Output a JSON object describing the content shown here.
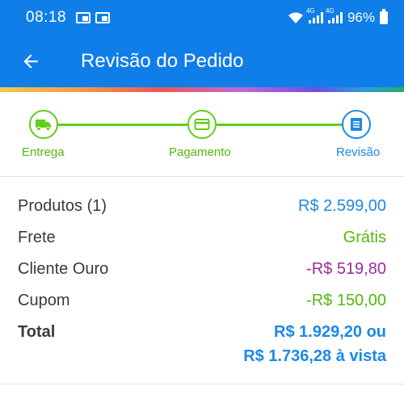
{
  "status_bar": {
    "time": "08:18",
    "network_tag_1": "4G",
    "network_tag_2": "4G",
    "battery": "96%",
    "icons": [
      "notification-icon",
      "notification-icon",
      "wifi-icon",
      "signal-icon",
      "signal-icon",
      "battery-icon"
    ]
  },
  "app_bar": {
    "title": "Revisão do Pedido",
    "back_icon": "arrow-left-icon"
  },
  "stepper": {
    "steps": [
      {
        "label": "Entrega",
        "icon": "truck-icon",
        "state": "completed"
      },
      {
        "label": "Pagamento",
        "icon": "credit-card-icon",
        "state": "completed"
      },
      {
        "label": "Revisão",
        "icon": "list-icon",
        "state": "current"
      }
    ],
    "colors": {
      "completed": "#5fcf1a",
      "current": "#1e88e5"
    }
  },
  "summary": {
    "rows": [
      {
        "label": "Produtos (1)",
        "value": "R$ 2.599,00"
      },
      {
        "label": "Frete",
        "value": "Grátis"
      },
      {
        "label": "Cliente Ouro",
        "value": "-R$ 519,80"
      },
      {
        "label": "Cupom",
        "value": "-R$ 150,00"
      }
    ],
    "total": {
      "label": "Total",
      "value_line1": "R$ 1.929,20 ou",
      "value_line2": "R$ 1.736,28 à vista"
    }
  },
  "colors": {
    "primary": "#0f7ee8",
    "accent_blue": "#1e88e5",
    "green": "#54b70f",
    "purple": "#9b2b9b"
  }
}
